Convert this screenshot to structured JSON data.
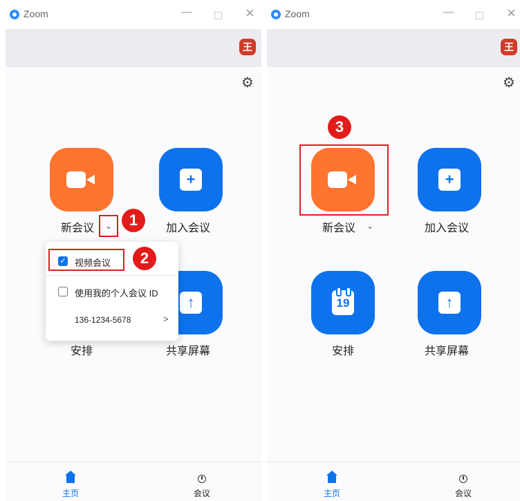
{
  "window": {
    "title": "Zoom",
    "minimize": "—",
    "close": "×",
    "avatar_text": "王"
  },
  "buttons": {
    "new_meeting": "新会议",
    "join": "加入会议",
    "schedule": "安排",
    "share": "共享屏幕",
    "calendar_day": "19",
    "plus": "+",
    "share_arrow": "↑"
  },
  "dropdown": {
    "video_meeting": "视频会议",
    "personal_id": "使用我的个人会议 ID",
    "meeting_id": "136-1234-5678",
    "arrow": ">"
  },
  "tabs": {
    "home": "主页",
    "meetings": "会议"
  },
  "steps": {
    "one": "1",
    "two": "2",
    "three": "3"
  },
  "colors": {
    "orange": "#ff742e",
    "blue": "#0e72ed",
    "annotation_red": "#e31b1b"
  }
}
